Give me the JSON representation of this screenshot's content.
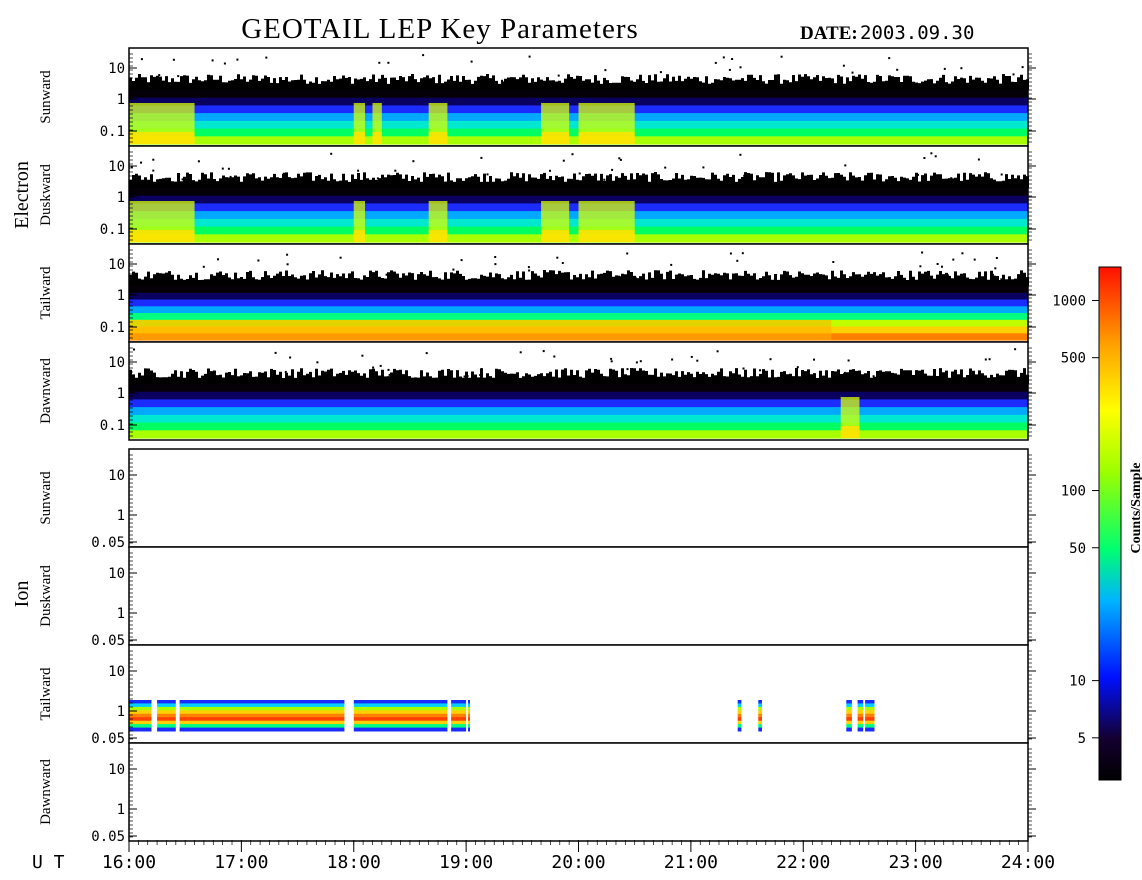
{
  "header": {
    "title": "GEOTAIL LEP Key Parameters",
    "date_label": "DATE:",
    "date_value": "2003.09.30"
  },
  "groups": {
    "electron": "Electron",
    "ion": "Ion"
  },
  "panel_labels": [
    "Sunward",
    "Duskward",
    "Tailward",
    "Dawnward",
    "Sunward",
    "Duskward",
    "Tailward",
    "Dawnward"
  ],
  "electron_ticks": [
    "10",
    "1",
    "0.1"
  ],
  "ion_ticks": [
    "10",
    "1",
    "0.05"
  ],
  "x_axis": {
    "label": "U T",
    "ticks": [
      "16:00",
      "17:00",
      "18:00",
      "19:00",
      "20:00",
      "21:00",
      "22:00",
      "23:00",
      "24:00"
    ]
  },
  "colorbar": {
    "label": "Counts/Sample",
    "ticks": [
      "1000",
      "500",
      "100",
      "50",
      "10",
      "5"
    ]
  },
  "chart_data": {
    "type": "heatmap",
    "title": "GEOTAIL LEP Key Parameters",
    "xlabel": "U T",
    "x_range": [
      "16:00",
      "24:00"
    ],
    "colorbar": {
      "label": "Counts/Sample",
      "scale": "log",
      "range": [
        3,
        1500
      ],
      "ticks": [
        5,
        10,
        50,
        100,
        500,
        1000
      ]
    },
    "panels": [
      {
        "species": "Electron",
        "direction": "Sunward",
        "y_scale": "log",
        "ticks": [
          10,
          1,
          0.1
        ],
        "enhancements": [
          [
            "16:00",
            "16:35"
          ],
          [
            "18:00",
            "18:06"
          ],
          [
            "18:10",
            "18:15"
          ],
          [
            "18:40",
            "18:50"
          ],
          [
            "19:40",
            "19:55"
          ],
          [
            "20:00",
            "20:30"
          ]
        ]
      },
      {
        "species": "Electron",
        "direction": "Duskward",
        "y_scale": "log",
        "ticks": [
          10,
          1,
          0.1
        ],
        "enhancements": [
          [
            "16:00",
            "16:35"
          ],
          [
            "18:00",
            "18:06"
          ],
          [
            "18:40",
            "18:50"
          ],
          [
            "19:40",
            "19:55"
          ],
          [
            "20:00",
            "20:30"
          ]
        ]
      },
      {
        "species": "Electron",
        "direction": "Tailward",
        "y_scale": "log",
        "ticks": [
          10,
          1,
          0.1
        ],
        "enhancements": [
          [
            "16:00",
            "22:15"
          ]
        ]
      },
      {
        "species": "Electron",
        "direction": "Dawnward",
        "y_scale": "log",
        "ticks": [
          10,
          1,
          0.1
        ],
        "enhancements": [
          [
            "22:20",
            "22:30"
          ]
        ]
      },
      {
        "species": "Ion",
        "direction": "Sunward",
        "y_scale": "log",
        "ticks": [
          10,
          1,
          0.05
        ],
        "intervals": []
      },
      {
        "species": "Ion",
        "direction": "Duskward",
        "y_scale": "log",
        "ticks": [
          10,
          1,
          0.05
        ],
        "intervals": []
      },
      {
        "species": "Ion",
        "direction": "Tailward",
        "y_scale": "log",
        "ticks": [
          10,
          1,
          0.05
        ],
        "intervals": [
          [
            "16:00",
            "16:12"
          ],
          [
            "16:15",
            "16:25"
          ],
          [
            "16:27",
            "17:55"
          ],
          [
            "18:00",
            "18:50"
          ],
          [
            "18:52",
            "19:00"
          ],
          [
            "19:01",
            "19:02"
          ],
          [
            "21:25",
            "21:27"
          ],
          [
            "21:36",
            "21:38"
          ],
          [
            "22:23",
            "22:26"
          ],
          [
            "22:29",
            "22:32"
          ],
          [
            "22:33",
            "22:38"
          ]
        ]
      },
      {
        "species": "Ion",
        "direction": "Dawnward",
        "y_scale": "log",
        "ticks": [
          10,
          1,
          0.05
        ],
        "intervals": []
      }
    ]
  }
}
